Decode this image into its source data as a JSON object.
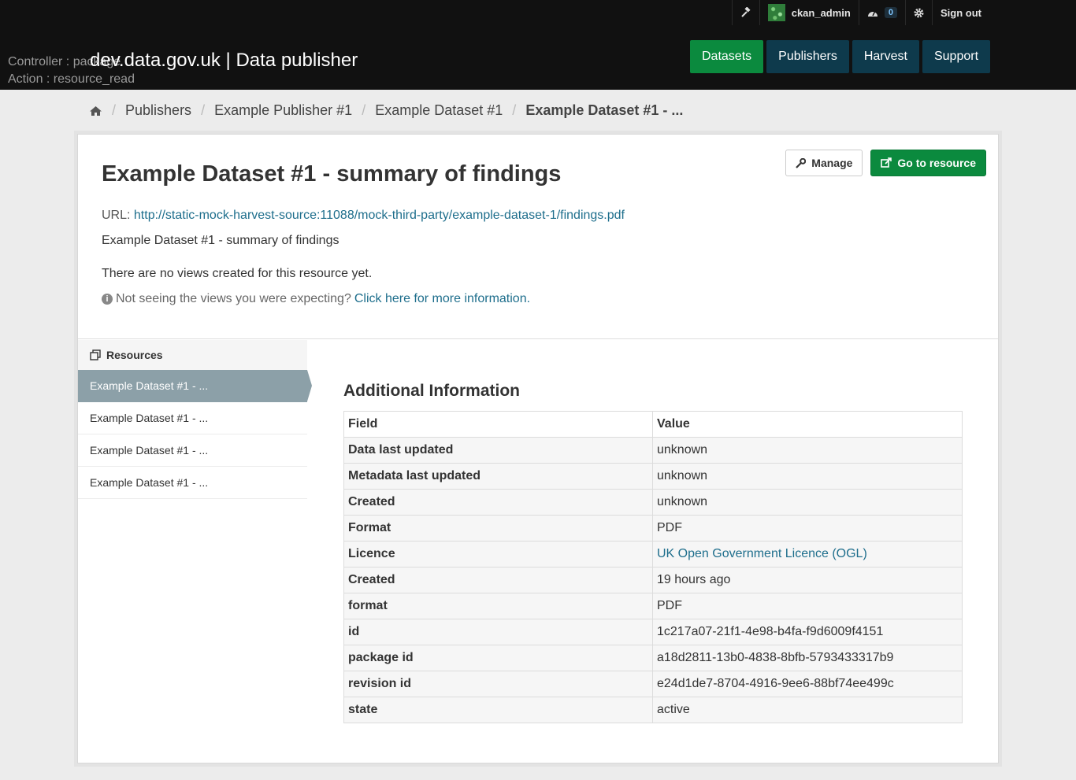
{
  "account": {
    "username": "ckan_admin",
    "dashboard_count": "0",
    "signout_label": "Sign out"
  },
  "debug": {
    "controller": "Controller : package",
    "action": "Action : resource_read"
  },
  "site_title": "dev.data.gov.uk | Data publisher",
  "nav": [
    "Datasets",
    "Publishers",
    "Harvest",
    "Support"
  ],
  "breadcrumb": [
    "Publishers",
    "Example Publisher #1",
    "Example Dataset #1",
    "Example Dataset #1 - ..."
  ],
  "resource": {
    "manage_label": "Manage",
    "goto_label": "Go to resource",
    "title": "Example Dataset #1 - summary of findings",
    "url_label": "URL:",
    "url": "http://static-mock-harvest-source:11088/mock-third-party/example-dataset-1/findings.pdf",
    "description": "Example Dataset #1 - summary of findings",
    "no_views": "There are no views created for this resource yet.",
    "hint_text": "Not seeing the views you were expecting?",
    "hint_link": "Click here for more information."
  },
  "sidebar": {
    "heading": "Resources",
    "items": [
      "Example Dataset #1 - ...",
      "Example Dataset #1 - ...",
      "Example Dataset #1 - ...",
      "Example Dataset #1 - ..."
    ]
  },
  "additional": {
    "heading": "Additional Information",
    "col_field": "Field",
    "col_value": "Value",
    "rows": [
      {
        "field": "Data last updated",
        "value": "unknown"
      },
      {
        "field": "Metadata last updated",
        "value": "unknown"
      },
      {
        "field": "Created",
        "value": "unknown"
      },
      {
        "field": "Format",
        "value": "PDF"
      },
      {
        "field": "Licence",
        "value": "UK Open Government Licence (OGL)"
      },
      {
        "field": "Created",
        "value": "19 hours ago"
      },
      {
        "field": "format",
        "value": "PDF"
      },
      {
        "field": "id",
        "value": "1c217a07-21f1-4e98-b4fa-f9d6009f4151"
      },
      {
        "field": "package id",
        "value": "a18d2811-13b0-4838-8bfb-5793433317b9"
      },
      {
        "field": "revision id",
        "value": "e24d1de7-8704-4916-9ee6-88bf74ee499c"
      },
      {
        "field": "state",
        "value": "active"
      }
    ]
  },
  "colors": {
    "masthead": "#111111",
    "nav": "#0e3a4c",
    "nav_active": "#0b8a3e",
    "link": "#1e6e8c",
    "sidebar_active": "#8ca0a8"
  }
}
